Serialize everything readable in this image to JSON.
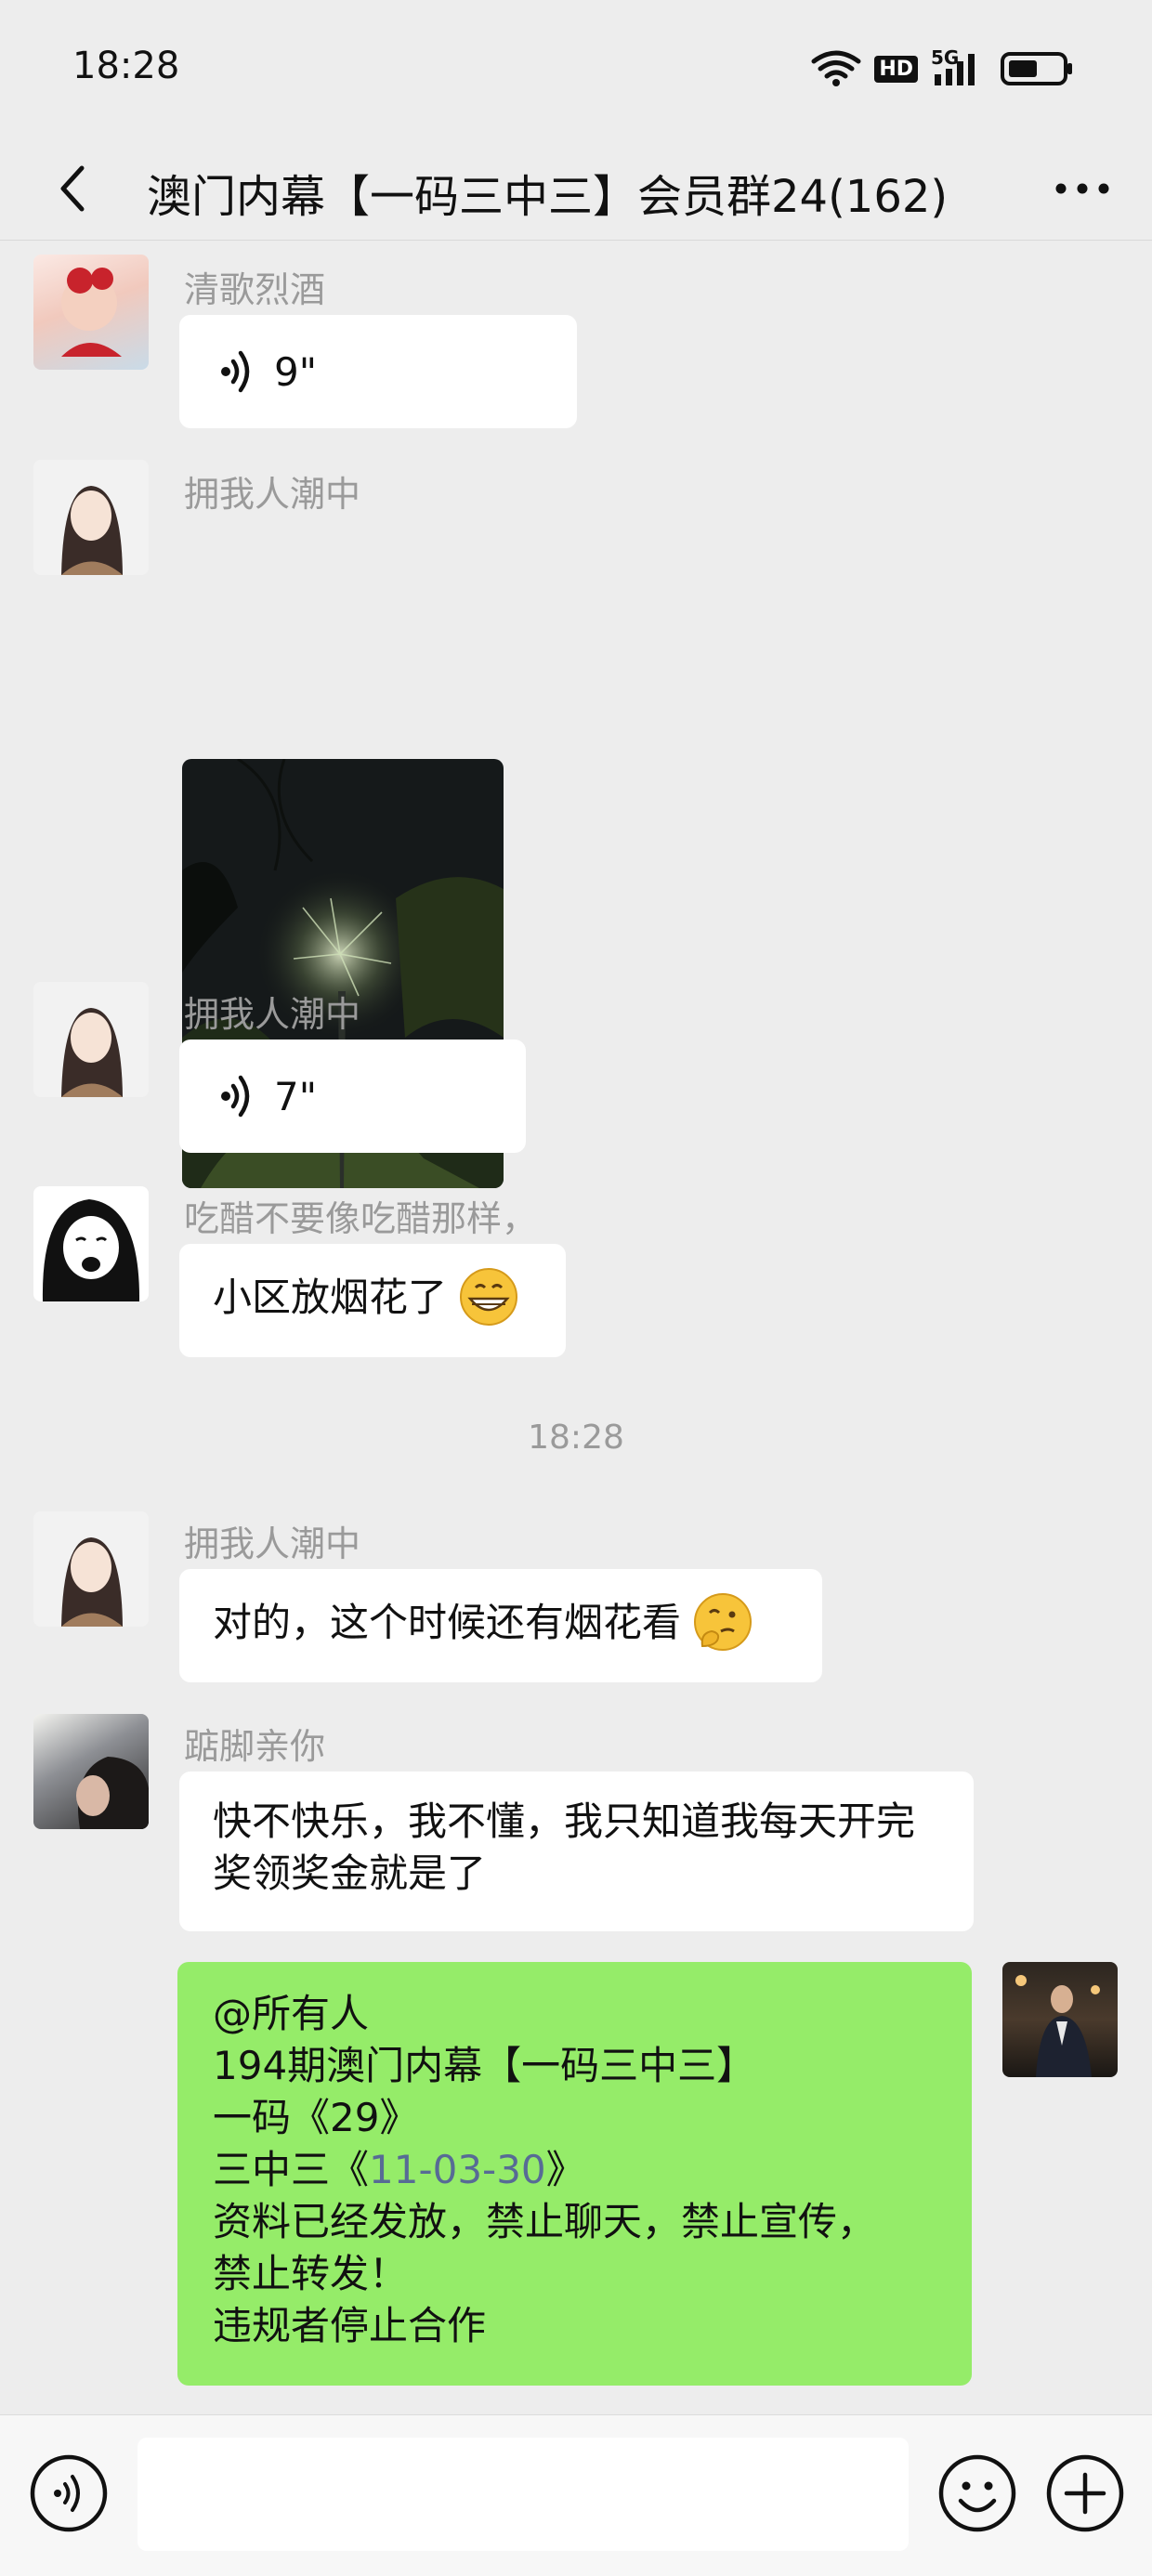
{
  "status_bar": {
    "time": "18:28",
    "network": "5G",
    "hd_badge": "HD"
  },
  "header": {
    "title": "澳门内幕【一码三中三】会员群24(162)"
  },
  "messages": [
    {
      "sender": "清歌烈酒",
      "type": "voice",
      "duration": "9\""
    },
    {
      "sender": "拥我人潮中",
      "type": "image"
    },
    {
      "sender": "拥我人潮中",
      "type": "voice",
      "duration": "7\""
    },
    {
      "sender": "吃醋不要像吃醋那样，",
      "type": "text",
      "text": "小区放烟花了"
    },
    {
      "sender": "拥我人潮中",
      "type": "text",
      "text": "对的，这个时候还有烟花看"
    },
    {
      "sender": "踮脚亲你",
      "type": "text",
      "text": "快不快乐，我不懂，我只知道我每天开完奖领奖金就是了"
    }
  ],
  "timestamp": "18:28",
  "my_message": {
    "line1": "@所有人",
    "line2": "194期澳门内幕【一码三中三】",
    "line3": "一码《29》",
    "line4_prefix": "三中三《",
    "line4_link": "11-03-30",
    "line4_suffix": "》",
    "line5": "资料已经发放，禁止聊天，禁止宣传，",
    "line6": "禁止转发！",
    "line7": "违规者停止合作"
  },
  "input": {
    "value": "",
    "placeholder": ""
  },
  "colors": {
    "bg": "#ededed",
    "my_bubble": "#95ec69",
    "link": "#576b95",
    "sender": "#9a9a9a"
  }
}
